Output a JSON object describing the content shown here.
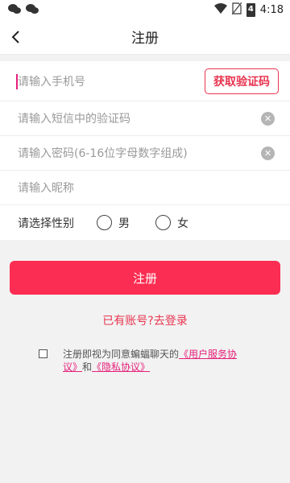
{
  "status_bar": {
    "time": "4:18",
    "battery_level": "4",
    "left_icons": [
      "wechat-icon",
      "wechat-icon"
    ],
    "right_icons": [
      "wifi-icon",
      "no-sim-icon",
      "battery-icon"
    ]
  },
  "app_bar": {
    "title": "注册",
    "back_icon": "chevron-left-icon"
  },
  "form": {
    "phone_placeholder": "请输入手机号",
    "get_code_label": "获取验证码",
    "sms_code_placeholder": "请输入短信中的验证码",
    "password_placeholder": "请输入密码(6-16位字母数字组成)",
    "nickname_placeholder": "请输入昵称",
    "gender_label": "请选择性别",
    "gender_options": [
      "男",
      "女"
    ]
  },
  "register_button": "注册",
  "login_link": "已有账号?去登录",
  "agreement": {
    "prefix": "注册即视为同意蝙蝠聊天的",
    "user_agreement": "《用户服务协议》",
    "and": "和",
    "privacy": "《隐私协议》"
  },
  "colors": {
    "accent": "#fb2d52",
    "link": "#e6207a",
    "bg": "#f2f2f2"
  }
}
